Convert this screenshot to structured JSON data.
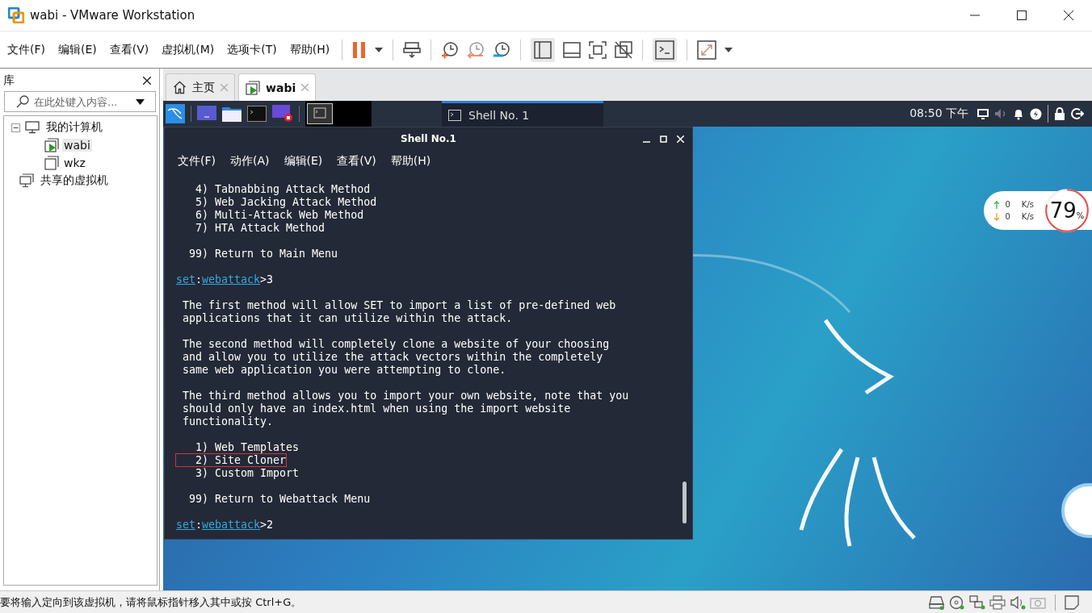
{
  "window": {
    "title": "wabi - VMware Workstation"
  },
  "menu": [
    "文件(F)",
    "编辑(E)",
    "查看(V)",
    "虚拟机(M)",
    "选项卡(T)",
    "帮助(H)"
  ],
  "library": {
    "title": "库",
    "search": {
      "placeholder": "在此处键入内容..."
    },
    "tree": [
      {
        "label": "我的计算机",
        "kind": "computer",
        "expanded": true,
        "selected": false,
        "children": [
          {
            "label": "wabi",
            "kind": "vm-running",
            "selected": true
          },
          {
            "label": "wkz",
            "kind": "vm",
            "selected": false
          }
        ]
      },
      {
        "label": "共享的虚拟机",
        "kind": "shared",
        "selected": false
      }
    ]
  },
  "tabs": [
    {
      "label": "主页",
      "kind": "home",
      "selected": false
    },
    {
      "label": "wabi",
      "kind": "vm",
      "selected": true
    }
  ],
  "guest": {
    "panel": {
      "task": "Shell No. 1",
      "clock": "08:50 下午"
    },
    "net_widget": {
      "up": "0",
      "down": "0",
      "unit_up": "K/s",
      "unit_down": "K/s",
      "percent": "79",
      "percent_sign": "%",
      "level": 0.79
    },
    "terminal": {
      "title": "Shell No.1",
      "menu": [
        "文件(F)",
        "动作(A)",
        "编辑(E)",
        "查看(V)",
        "帮助(H)"
      ],
      "lines": [
        {
          "kind": "text",
          "text": "  4) Tabnabbing Attack Method"
        },
        {
          "kind": "text",
          "text": "  5) Web Jacking Attack Method"
        },
        {
          "kind": "text",
          "text": "  6) Multi-Attack Web Method"
        },
        {
          "kind": "text",
          "text": "  7) HTA Attack Method"
        },
        {
          "kind": "blank"
        },
        {
          "kind": "text",
          "text": " 99) Return to Main Menu"
        },
        {
          "kind": "blank"
        },
        {
          "kind": "prompt",
          "host": "set",
          "sep": ":",
          "context": "webattack",
          "input": ">3"
        },
        {
          "kind": "blank"
        },
        {
          "kind": "text",
          "text": "The first method will allow SET to import a list of pre-defined web"
        },
        {
          "kind": "text",
          "text": "applications that it can utilize within the attack."
        },
        {
          "kind": "blank"
        },
        {
          "kind": "text",
          "text": "The second method will completely clone a website of your choosing"
        },
        {
          "kind": "text",
          "text": "and allow you to utilize the attack vectors within the completely"
        },
        {
          "kind": "text",
          "text": "same web application you were attempting to clone."
        },
        {
          "kind": "blank"
        },
        {
          "kind": "text",
          "text": "The third method allows you to import your own website, note that you"
        },
        {
          "kind": "text",
          "text": "should only have an index.html when using the import website"
        },
        {
          "kind": "text",
          "text": "functionality."
        },
        {
          "kind": "blank"
        },
        {
          "kind": "text",
          "text": "  1) Web Templates"
        },
        {
          "kind": "text",
          "text": "  2) Site Cloner",
          "boxed": true
        },
        {
          "kind": "text",
          "text": "  3) Custom Import"
        },
        {
          "kind": "blank"
        },
        {
          "kind": "text",
          "text": " 99) Return to Webattack Menu"
        },
        {
          "kind": "blank"
        },
        {
          "kind": "prompt",
          "host": "set",
          "sep": ":",
          "context": "webattack",
          "input": ">2"
        }
      ]
    }
  },
  "status_bar": {
    "text": "要将输入定向到该虚拟机，请将鼠标指针移入其中或按 Ctrl+G。"
  }
}
